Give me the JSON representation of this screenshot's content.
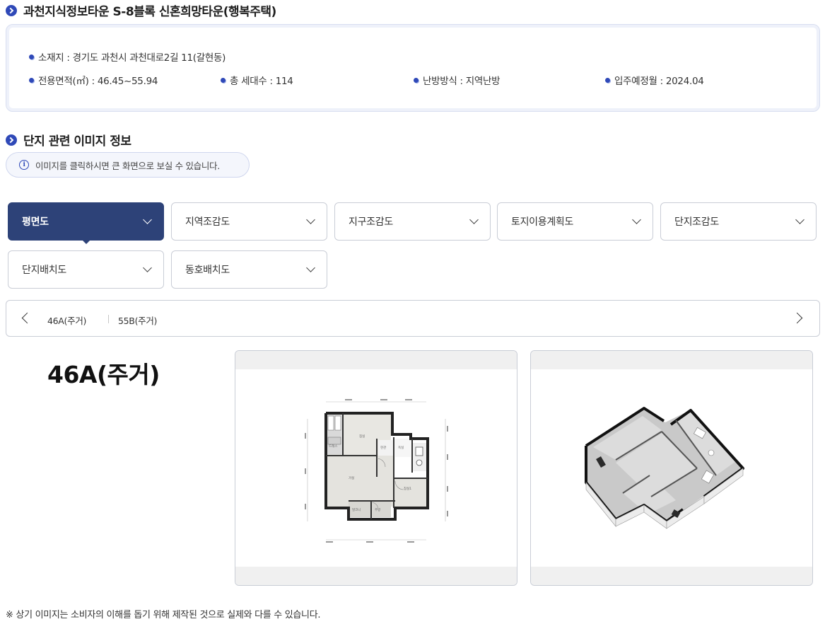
{
  "complex": {
    "title": "과천지식정보타운 S-8블록 신혼희망타운(행복주택)",
    "location": "소재지 : 경기도 과천시 과천대로2길 11(갈현동)",
    "area": "전용면적(㎡) : 46.45~55.94",
    "households": "총 세대수 : 114",
    "heating": "난방방식 : 지역난방",
    "move_in": "입주예정월 : 2024.04"
  },
  "images_section": {
    "title": "단지 관련 이미지 정보",
    "notice": "이미지를 클릭하시면 큰 화면으로 보실 수 있습니다."
  },
  "tabs": [
    {
      "label": "평면도",
      "active": true
    },
    {
      "label": "지역조감도"
    },
    {
      "label": "지구조감도"
    },
    {
      "label": "토지이용계획도"
    },
    {
      "label": "단지조감도"
    },
    {
      "label": "단지배치도"
    },
    {
      "label": "동호배치도"
    }
  ],
  "unit_types": [
    "46A(주거)",
    "55B(주거)"
  ],
  "selected_type": "46A(주거)",
  "icons": {
    "section": "chevron-circle-icon",
    "info": "info-icon",
    "dropdown": "chevron-down-icon",
    "prev": "chevron-left-icon",
    "next": "chevron-right-icon"
  },
  "colors": {
    "accent": "#2f49b8",
    "active_tab": "#2d4278"
  },
  "footnote": "※ 상기 이미지는 소비자의 이해를 돕기 위해 제작된 것으로 실제와 다를 수 있습니다."
}
